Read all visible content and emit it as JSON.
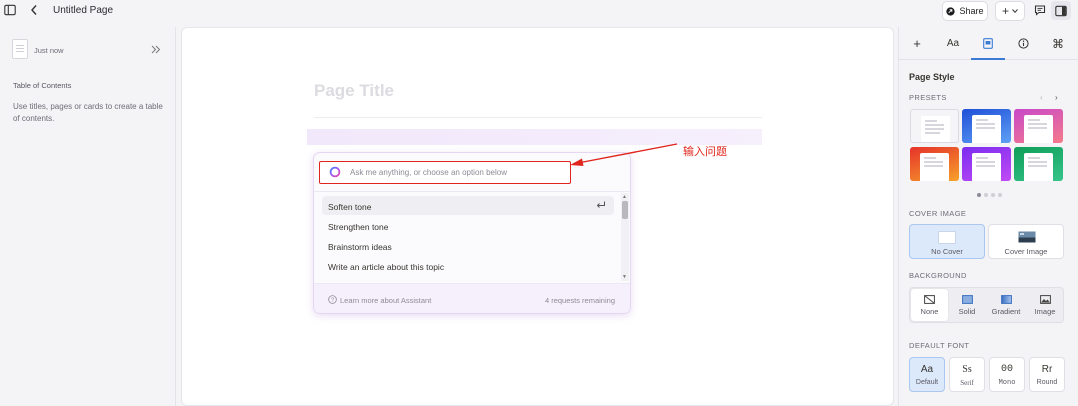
{
  "topbar": {
    "page_title": "Untitled Page",
    "share_label": "Share",
    "add_label": "+",
    "colors": {
      "accent": "#1d1d1f"
    }
  },
  "left_panel": {
    "timestamp": "Just now",
    "toc_title": "Table of Contents",
    "toc_hint": "Use titles, pages or cards to create a table of contents."
  },
  "canvas": {
    "title_placeholder": "Page Title"
  },
  "assistant": {
    "input_placeholder": "Ask me anything, or choose an option below",
    "items": [
      {
        "label": "Soften tone",
        "active": true
      },
      {
        "label": "Strengthen tone"
      },
      {
        "label": "Brainstorm ideas"
      },
      {
        "label": "Write an article about this topic"
      }
    ],
    "footer_left": "Learn more about Assistant",
    "footer_right": "4 requests remaining"
  },
  "annotation": {
    "text": "输入问题",
    "color": "#e0261c"
  },
  "right_panel": {
    "tabs": [
      "+",
      "Aa",
      "page-style-icon",
      "info-icon",
      "⌘"
    ],
    "active_tab": 2,
    "section_title": "Page Style",
    "presets_label": "PRESETS",
    "presets": [
      "#f5f5f7",
      "#3a6ee8",
      "#e85d8f",
      "#f0582a",
      "#a03cf0",
      "#1ca86a"
    ],
    "cover_label": "COVER IMAGE",
    "cover_options": [
      "No Cover",
      "Cover Image"
    ],
    "background_label": "BACKGROUND",
    "background_options": [
      "None",
      "Solid",
      "Gradient",
      "Image"
    ],
    "font_label": "DEFAULT FONT",
    "font_options": [
      {
        "glyph": "Aa",
        "label": "Default"
      },
      {
        "glyph": "Ss",
        "label": "Serif"
      },
      {
        "glyph": "00",
        "label": "Mono"
      },
      {
        "glyph": "Rr",
        "label": "Round"
      }
    ],
    "colors": {
      "accent": "#3a7bd5",
      "selected_bg": "#dce9fb"
    }
  }
}
